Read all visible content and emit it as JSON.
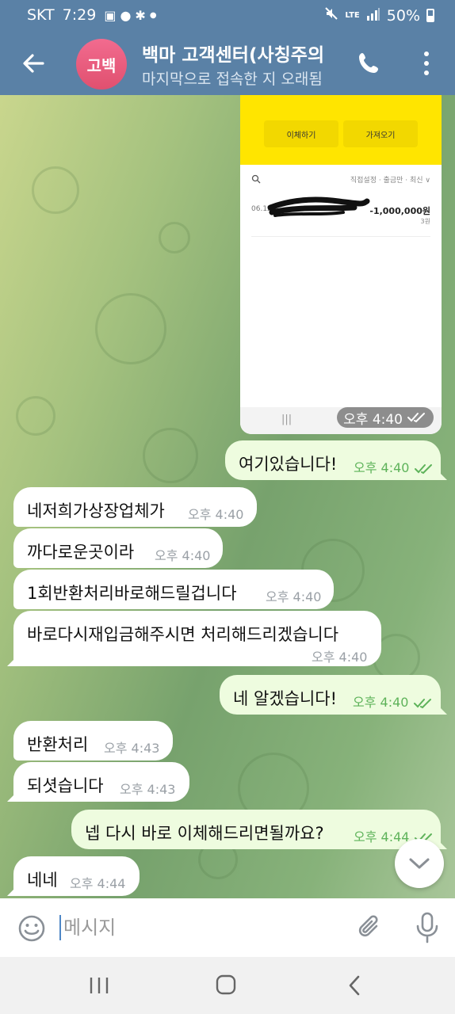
{
  "status_bar": {
    "carrier": "SKT",
    "time": "7:29",
    "network": "LTE",
    "battery": "50%"
  },
  "header": {
    "avatar_initials": "고백",
    "title": "백마 고객센터(사칭주의",
    "subtitle": "마지막으로 접속한 지 오래됨"
  },
  "photo_message": {
    "transfer_button": "이체하기",
    "import_button": "가져오기",
    "filter_text": "직접설정 · 출금만 · 최신 ∨",
    "date": "06.12",
    "amount": "-1,000,000원",
    "sub_text": "3원",
    "time": "오후 4:40"
  },
  "messages": [
    {
      "direction": "out",
      "text": "여기있습니다!",
      "time": "오후 4:40",
      "read": true
    },
    {
      "direction": "in",
      "text": "네저희가상장업체가",
      "time": "오후 4:40"
    },
    {
      "direction": "in",
      "text": "까다로운곳이라",
      "time": "오후 4:40"
    },
    {
      "direction": "in",
      "text": "1회반환처리바로해드릴겁니다",
      "time": "오후 4:40"
    },
    {
      "direction": "in",
      "text": "바로다시재입금해주시면 처리해드리겠습니다",
      "time": "오후 4:40"
    },
    {
      "direction": "out",
      "text": "네 알겠습니다!",
      "time": "오후 4:40",
      "read": true
    },
    {
      "direction": "in",
      "text": "반환처리",
      "time": "오후 4:43"
    },
    {
      "direction": "in",
      "text": "되셧습니다",
      "time": "오후 4:43"
    },
    {
      "direction": "out",
      "text": "넵 다시 바로 이체해드리면될까요?",
      "time": "오후 4:44",
      "read": true
    },
    {
      "direction": "in",
      "text": "네네",
      "time": "오후 4:44"
    }
  ],
  "input": {
    "placeholder": "메시지"
  },
  "icons": {
    "back": "arrow-left-icon",
    "call": "phone-icon",
    "menu": "more-vertical-icon",
    "emoji": "smiley-icon",
    "attach": "paperclip-icon",
    "mic": "microphone-icon",
    "scroll": "chevron-down-icon"
  },
  "colors": {
    "header": "#5a81a6",
    "outgoing_bubble": "#eefcdf",
    "incoming_bubble": "#ffffff",
    "read_check": "#5eb35a",
    "avatar": "#ee5f83"
  }
}
